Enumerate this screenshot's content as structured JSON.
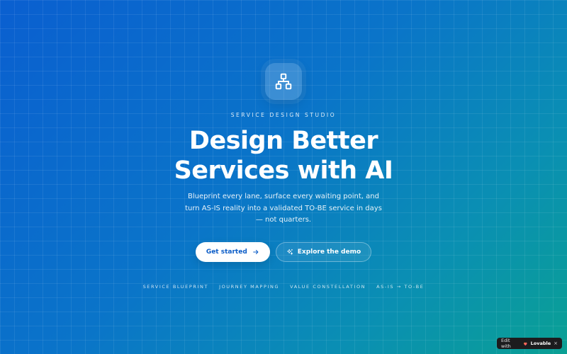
{
  "hero": {
    "eyebrow": "SERVICE DESIGN STUDIO",
    "title_line1": "Design Better",
    "title_line2": "Services with AI",
    "subtitle": "Blueprint every lane, surface every waiting point, and turn AS-IS reality into a validated TO-BE service in days — not quarters.",
    "logo_icon": "sitemap-icon"
  },
  "actions": {
    "primary_label": "Get started",
    "primary_icon": "arrow-right-icon",
    "secondary_label": "Explore the demo",
    "secondary_icon": "sparkles-icon"
  },
  "tags": [
    "SERVICE BLUEPRINT",
    "JOURNEY MAPPING",
    "VALUE CONSTELLATION",
    "AS-IS → TO-BE"
  ],
  "badge": {
    "prefix": "Edit with",
    "brand": "Lovable",
    "close": "×"
  },
  "colors": {
    "gradient_start": "#0a5fd0",
    "gradient_end": "#0aa094",
    "primary_button_text": "#0b5cc7",
    "badge_bg": "#1c1c1e"
  }
}
